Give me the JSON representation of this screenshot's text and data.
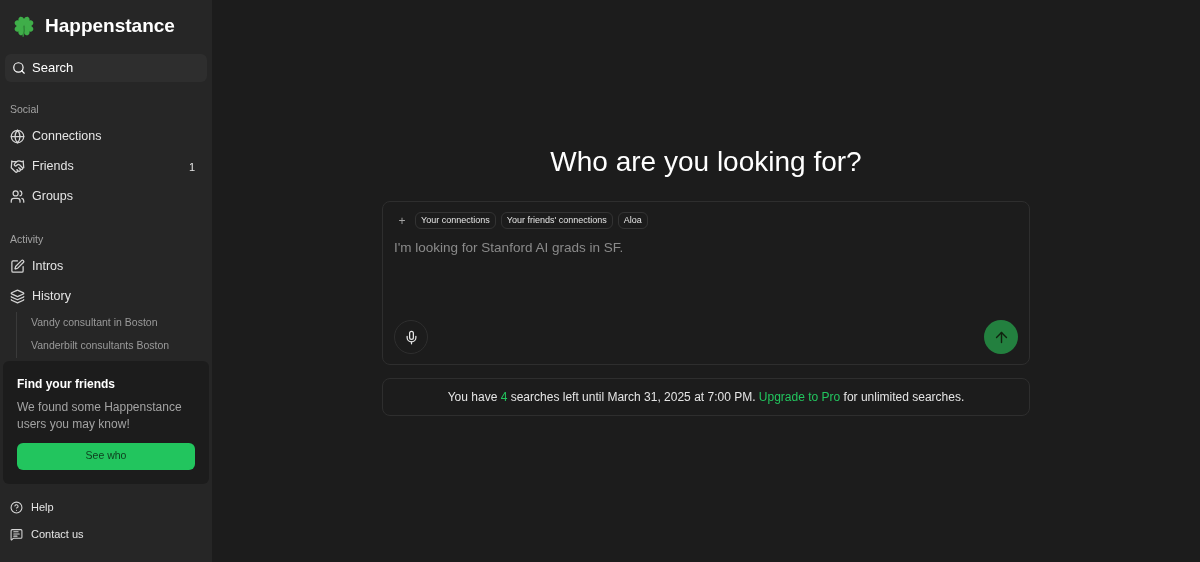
{
  "brand": {
    "name": "Happenstance"
  },
  "search_button": {
    "label": "Search"
  },
  "sections": [
    {
      "title": "Social",
      "items": [
        {
          "kind": "globe",
          "label": "Connections"
        },
        {
          "kind": "handshake",
          "label": "Friends",
          "count": "1"
        },
        {
          "kind": "users",
          "label": "Groups"
        }
      ]
    },
    {
      "title": "Activity",
      "items": [
        {
          "kind": "pen",
          "label": "Intros"
        },
        {
          "kind": "layers",
          "label": "History",
          "children": [
            {
              "label": "Vandy consultant in Boston"
            },
            {
              "label": "Vanderbilt consultants Boston"
            }
          ]
        }
      ]
    }
  ],
  "promo": {
    "title": "Find your friends",
    "text": "We found some Happenstance users you may know!",
    "button": "See who"
  },
  "footer_links": [
    {
      "kind": "help",
      "label": "Help"
    },
    {
      "kind": "message",
      "label": "Contact us"
    }
  ],
  "heading": "Who are you looking for?",
  "composer": {
    "add_label": "+",
    "chips": [
      "Your connections",
      "Your friends' connections",
      "Aloa"
    ],
    "placeholder": "I'm looking for Stanford AI grads in SF."
  },
  "notice": {
    "prefix": "You have ",
    "count": "4",
    "middle": " searches left until March 31, 2025 at 7:00 PM. ",
    "link": "Upgrade to Pro",
    "suffix": " for unlimited searches."
  }
}
